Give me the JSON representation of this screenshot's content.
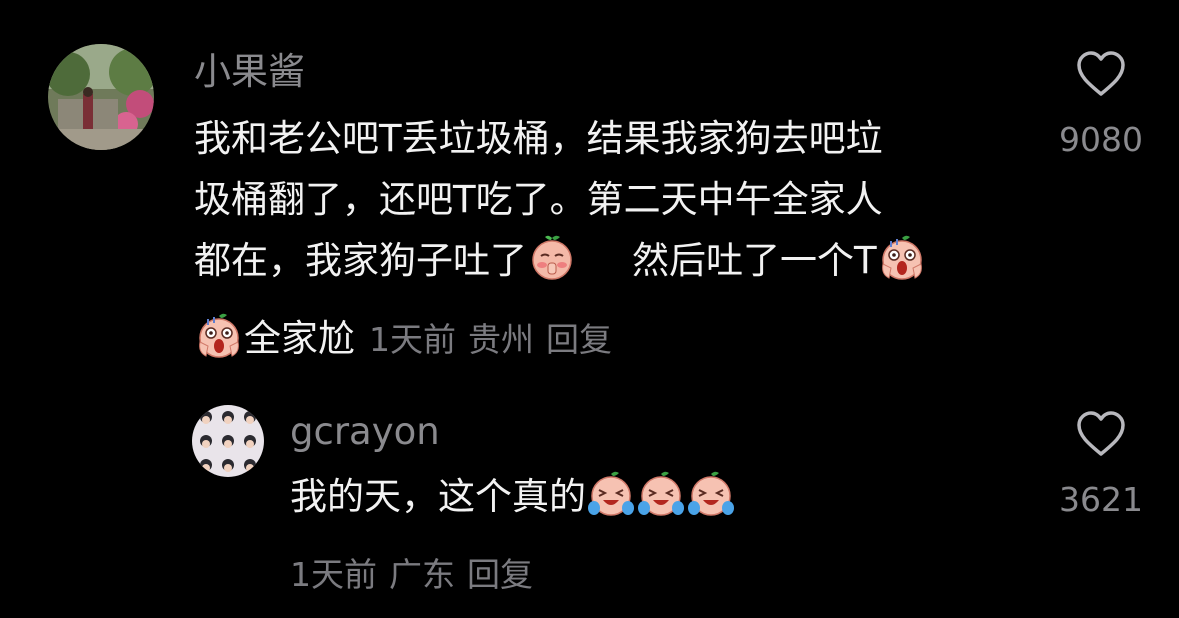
{
  "comments": [
    {
      "username": "小果酱",
      "text_lines": [
        "我和老公吧T丢垃圾桶，结果我家狗去吧垃",
        "圾桶翻了，还吧T吃了。第二天中午全家人",
        "都在，我家狗子吐了",
        "然后吐了一个T",
        "全家尬"
      ],
      "time": "1天前",
      "location": "贵州",
      "reply_label": "回复",
      "like_count": "9080"
    },
    {
      "username": "gcrayon",
      "text": "我的天，这个真的",
      "time": "1天前",
      "location": "广东",
      "reply_label": "回复",
      "like_count": "3621"
    }
  ],
  "icons": {
    "like": "heart-outline-icon",
    "emoji_shy": "shy-emoji-icon",
    "emoji_scream": "scream-emoji-icon",
    "emoji_cry": "crying-laugh-emoji-icon"
  },
  "colors": {
    "background": "#000000",
    "text_primary": "#f2f2f2",
    "text_secondary": "#8a8a8e"
  }
}
